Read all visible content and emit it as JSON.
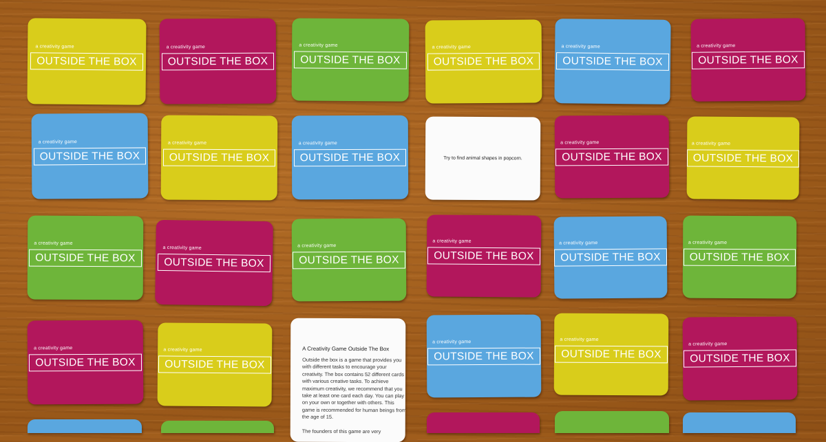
{
  "logo": {
    "small": "a creativity game",
    "big": "OUTSIDE THE BOX"
  },
  "task_card": {
    "text": "Try to find animal shapes in popcorn."
  },
  "rules_card": {
    "title": "A Creativity Game Outside The Box",
    "paragraph1": "Outside the box is a game that provides you with different tasks to encourage your creativity. The box contains 52 different cards with various creative tasks. To achieve maximum creativity, we recommend that you take at least one card each day. You can play on your own or together with others. This game is recommended for human beings from the age of 15.",
    "paragraph2": "The founders of this game are very"
  },
  "colors": {
    "yellow": "#d9cd1b",
    "magenta": "#b2175c",
    "green": "#6eb53a",
    "blue": "#5aa7df",
    "table": "#a3621f"
  }
}
